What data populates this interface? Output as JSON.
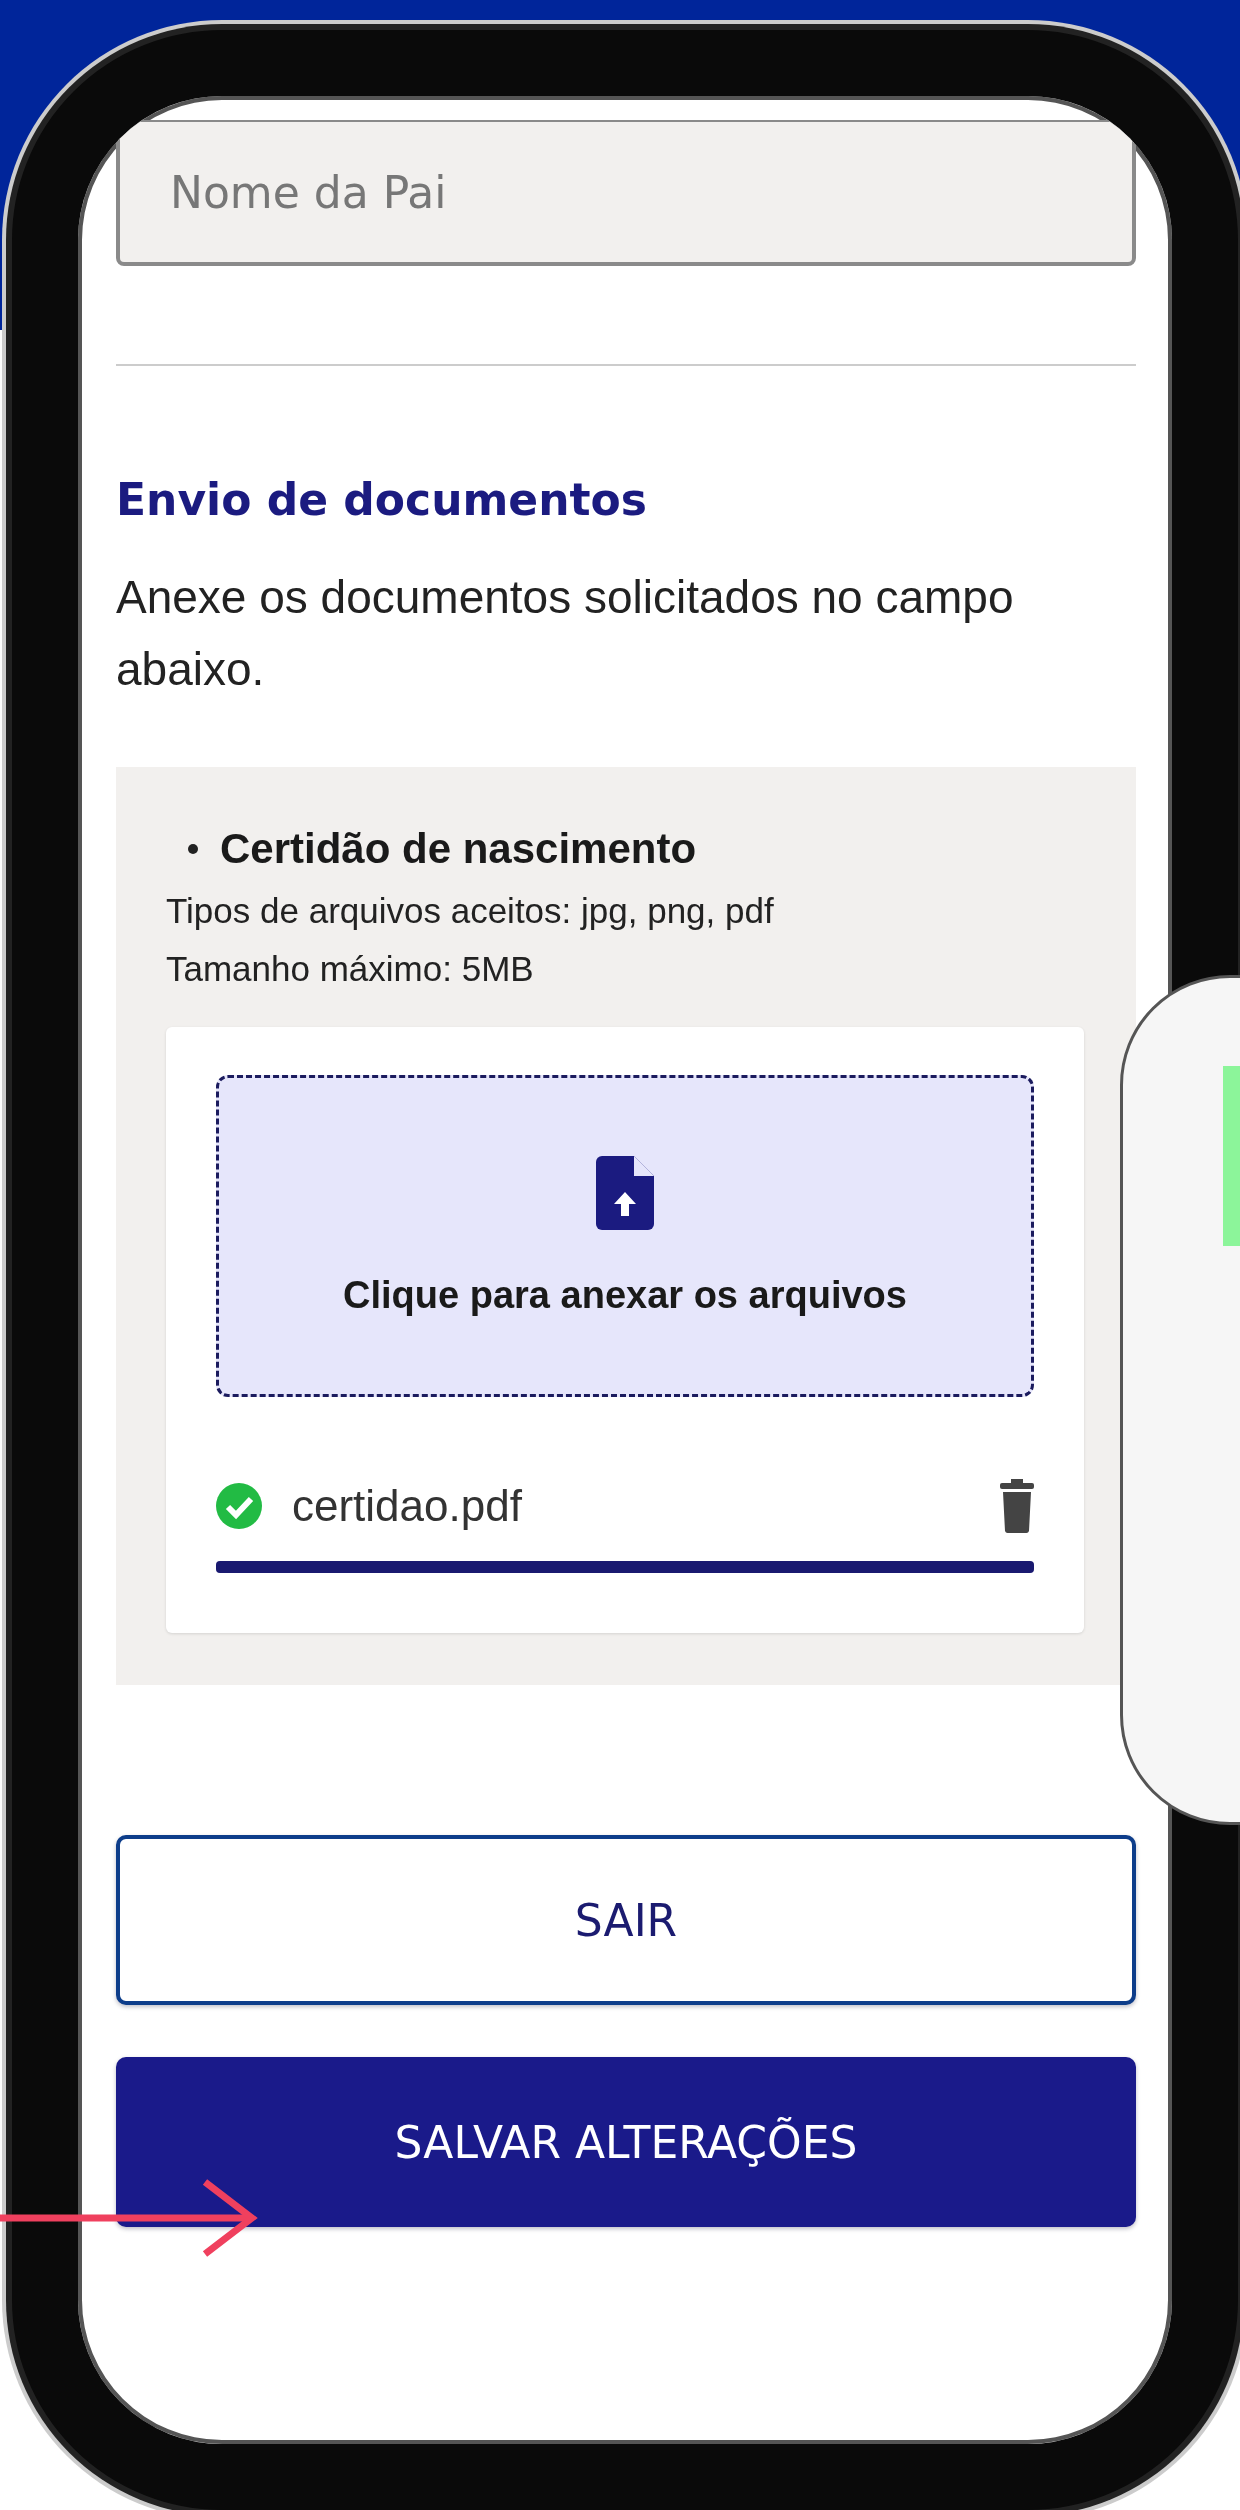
{
  "form": {
    "fields": [
      {
        "placeholder": "Nome da Pai"
      }
    ]
  },
  "documents": {
    "title": "Envio de documentos",
    "description": "Anexe os documentos solicitados no campo abaixo.",
    "items": [
      {
        "name": "Certidão de nascimento",
        "accepted_types": "Tipos de arquivos aceitos: jpg, png, pdf",
        "max_size": "Tamanho máximo: 5MB",
        "upload_prompt": "Clique para anexar os arquivos",
        "files": [
          {
            "name": "certidao.pdf",
            "uploaded": true,
            "level": 1
          }
        ]
      }
    ]
  },
  "buttons": [
    {
      "label": "SAIR",
      "kind": "outline"
    },
    {
      "label": "SALVAR ALTERAÇÕES",
      "kind": "filled"
    }
  ]
}
